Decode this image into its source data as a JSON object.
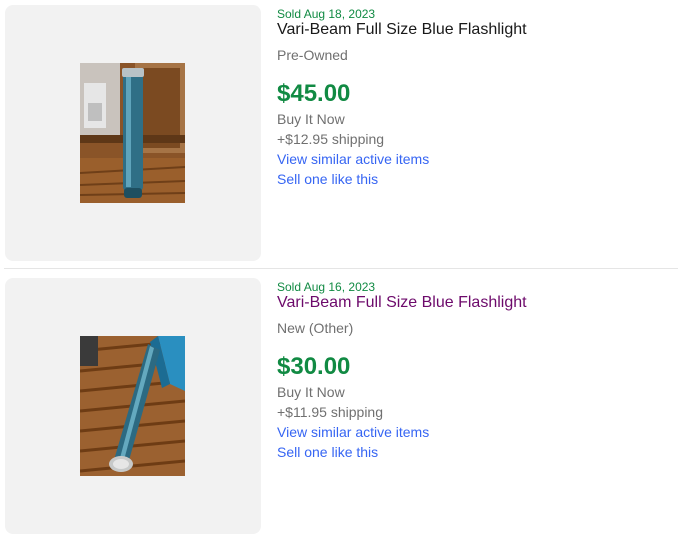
{
  "listings": [
    {
      "sold_text": "Sold Aug 18, 2023",
      "title": "Vari-Beam Full Size Blue Flashlight",
      "title_visited": false,
      "condition": "Pre-Owned",
      "price": "$45.00",
      "format": "Buy It Now",
      "shipping": "+$12.95 shipping",
      "similar_link": "View similar active items",
      "sell_link": "Sell one like this",
      "image_icon": "flashlight-upright-photo"
    },
    {
      "sold_text": "Sold Aug 16, 2023",
      "title": "Vari-Beam Full Size Blue Flashlight",
      "title_visited": true,
      "condition": "New (Other)",
      "price": "$30.00",
      "format": "Buy It Now",
      "shipping": "+$11.95 shipping",
      "similar_link": "View similar active items",
      "sell_link": "Sell one like this",
      "image_icon": "flashlight-diagonal-photo"
    }
  ],
  "colors": {
    "sold_green": "#118a43",
    "title_default": "#191919",
    "title_visited": "#6d0a6b",
    "secondary_text": "#707070",
    "link_blue": "#3665f3",
    "thumb_bg": "#f2f2f2"
  }
}
